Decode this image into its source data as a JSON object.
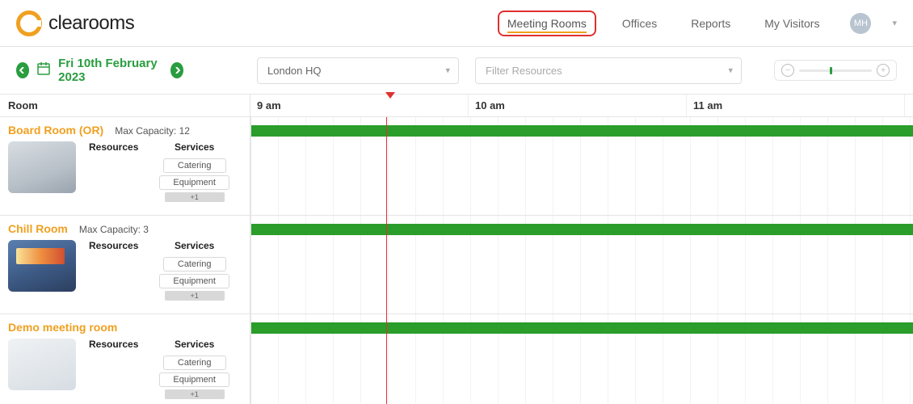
{
  "brand": {
    "name": "clearooms"
  },
  "nav": {
    "items": [
      {
        "label": "Meeting Rooms",
        "active": true
      },
      {
        "label": "Offices"
      },
      {
        "label": "Reports"
      },
      {
        "label": "My Visitors"
      }
    ],
    "avatar_initials": "MH"
  },
  "toolbar": {
    "date_label": "Fri 10th February 2023",
    "location_selected": "London HQ",
    "filter_placeholder": "Filter Resources"
  },
  "grid": {
    "room_header": "Room",
    "time_headers": [
      "9 am",
      "10 am",
      "11 am"
    ],
    "column_labels": {
      "resources": "Resources",
      "services": "Services"
    },
    "service_buttons": {
      "catering": "Catering",
      "equipment": "Equipment",
      "more": "+1"
    },
    "rooms": [
      {
        "name": "Board Room (OR)",
        "capacity_label": "Max Capacity: 12"
      },
      {
        "name": "Chill Room",
        "capacity_label": "Max Capacity: 3"
      },
      {
        "name": "Demo meeting room",
        "capacity_label": ""
      }
    ]
  }
}
